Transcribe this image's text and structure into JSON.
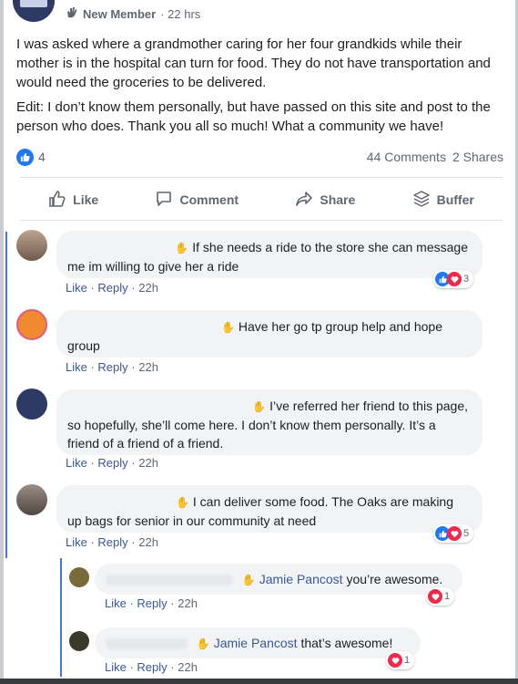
{
  "post": {
    "member_label": "New Member",
    "time": "· 22 hrs",
    "paragraph1": "I was asked where a grandmother caring for her four grandkids while their mother is in the hospital can turn for food. They do not have transportation and would need the groceries to be delivered.",
    "paragraph2": "Edit: I don’t know them personally, but have passed on this site and post to the person who does. Thank you all so much! What a community we have!",
    "like_count": "4",
    "comments_count": "44 Comments",
    "shares_count": "2 Shares"
  },
  "actions": {
    "like": "Like",
    "comment": "Comment",
    "share": "Share",
    "buffer": "Buffer"
  },
  "comments": [
    {
      "text_line1": "If she needs a ride to the store she can message",
      "text_line2": "me im willing to give her a ride",
      "like": "Like",
      "reply": "Reply",
      "time": "22h",
      "reactions": "3"
    },
    {
      "text_line1": "Have her go tp group help and hope",
      "text_line2": "group",
      "like": "Like",
      "reply": "Reply",
      "time": "22h"
    },
    {
      "text_line1": "I’ve referred her friend to this page,",
      "text_line2": "so hopefully, she’ll come here. I don’t know them personally. It’s a",
      "text_line3": "friend of a friend of a friend.",
      "like": "Like",
      "reply": "Reply",
      "time": "22h"
    },
    {
      "text_line1": "I can deliver some food. The Oaks are making",
      "text_line2": "up bags for senior in our community at need",
      "like": "Like",
      "reply": "Reply",
      "time": "22h",
      "reactions": "5"
    }
  ],
  "replies": [
    {
      "mention": "Jamie Pancost",
      "text": "you’re awesome.",
      "like": "Like",
      "reply": "Reply",
      "time": "22h",
      "reactions": "1"
    },
    {
      "mention": "Jamie Pancost",
      "text": "that’s awesome!",
      "like": "Like",
      "reply": "Reply",
      "time": "22h",
      "reactions": "1"
    }
  ],
  "colors": {
    "like_blue": "#2078f4",
    "love_red": "#f0284a",
    "link_blue": "#385898",
    "bubble_gray": "#f2f3f5"
  }
}
